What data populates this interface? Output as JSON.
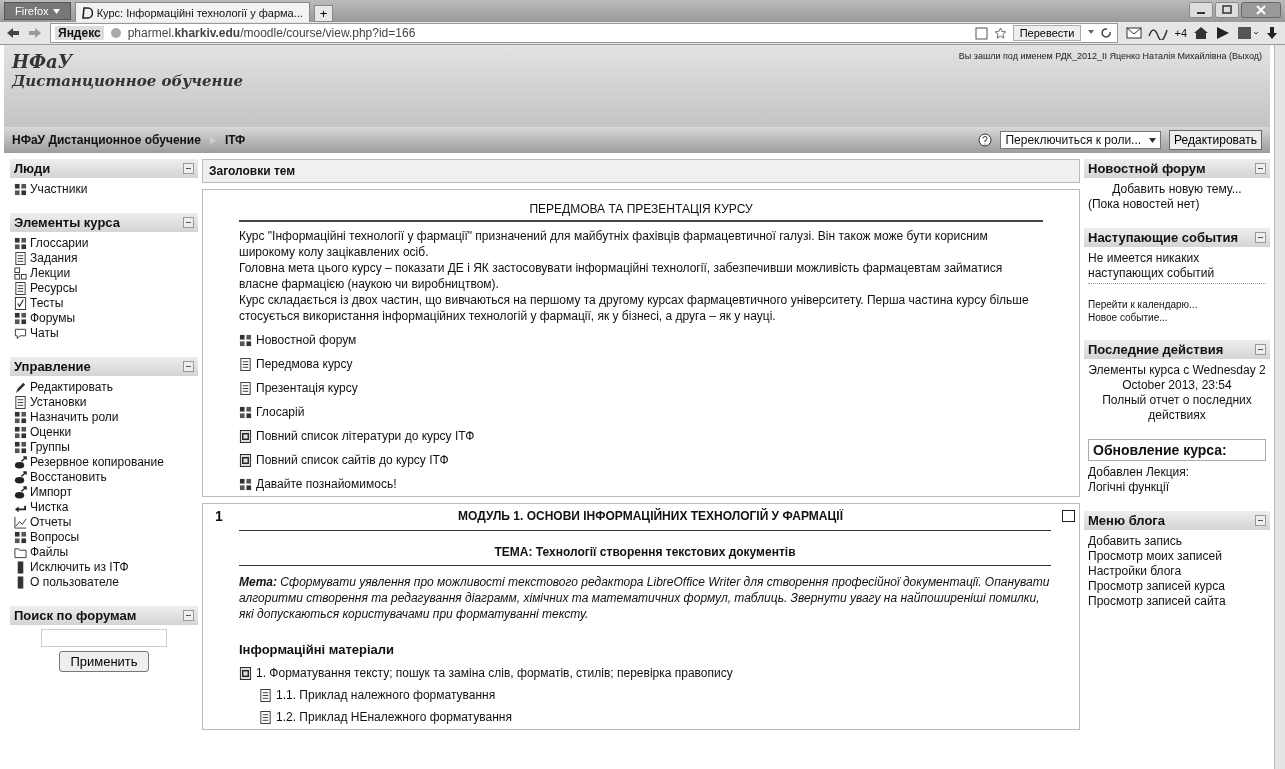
{
  "browser": {
    "menu_button": "Firefox",
    "tab_title": "Курс: Інформаційні технології у фарма...",
    "new_tab": "+",
    "url": "pharmel.**kharkiv.edu**/moodle/course/view.php?id=166",
    "search_brand": "Яндекс",
    "translate_button": "Перевести",
    "addon_badge": "+4"
  },
  "header": {
    "logo_title": "НФаУ",
    "logo_subtitle": "Дистанционное обучение",
    "login_text": "Вы зашли под именем РДК_2012_II Яценко Наталія Михайлівна",
    "logout_link": "(Выход)"
  },
  "navbar": {
    "breadcrumbs": [
      "НФаУ Дистанционное обучение",
      "ІТФ"
    ],
    "role_select": "Переключиться к роли...",
    "edit_button": "Редактировать"
  },
  "left_blocks": [
    {
      "title": "Люди",
      "kind": "list",
      "items": [
        {
          "label": "Участники",
          "kind": "people"
        }
      ]
    },
    {
      "title": "Элементы курса",
      "kind": "list",
      "items": [
        {
          "label": "Глоссарии",
          "kind": "glossary"
        },
        {
          "label": "Задания",
          "kind": "assign"
        },
        {
          "label": "Лекции",
          "kind": "lesson"
        },
        {
          "label": "Ресурсы",
          "kind": "resource"
        },
        {
          "label": "Тесты",
          "kind": "quiz"
        },
        {
          "label": "Форумы",
          "kind": "forum"
        },
        {
          "label": "Чаты",
          "kind": "chat"
        }
      ]
    },
    {
      "title": "Управление",
      "kind": "list",
      "items": [
        {
          "label": "Редактировать",
          "kind": "edit"
        },
        {
          "label": "Установки",
          "kind": "resource"
        },
        {
          "label": "Назначить роли",
          "kind": "people"
        },
        {
          "label": "Оценки",
          "kind": "forum"
        },
        {
          "label": "Группы",
          "kind": "people"
        },
        {
          "label": "Резервное копирование",
          "kind": "backup"
        },
        {
          "label": "Восстановить",
          "kind": "backup"
        },
        {
          "label": "Импорт",
          "kind": "backup"
        },
        {
          "label": "Чистка",
          "kind": "reset"
        },
        {
          "label": "Отчеты",
          "kind": "reports"
        },
        {
          "label": "Вопросы",
          "kind": "questions"
        },
        {
          "label": "Файлы",
          "kind": "files"
        },
        {
          "label": "Исключить из ІТФ",
          "kind": "user"
        },
        {
          "label": "О пользователе",
          "kind": "user"
        }
      ]
    },
    {
      "title": "Поиск по форумам",
      "kind": "search",
      "button": "Применить"
    }
  ],
  "center": {
    "header": "Заголовки тем",
    "intro": {
      "title": "ПЕРЕДМОВА ТА ПРЕЗЕНТАЦІЯ КУРСУ",
      "paragraphs": [
        "Курс \"Інформаційні технології у фармації\" призначений для майбутніх фахівців фармацевтичної галузі. Він також може бути корисним широкому колу зацікавлених осіб.",
        "Головна мета цього курсу – показати ДЕ і ЯК застосовувати інформаційні технології, забезпечивши можливість фармацевтам займатися власне фармацією (наукою чи виробництвом).",
        "Курс складається із двох частин, що вивчаються на першому та другому курсах фармацевтичного університету. Перша частина курсу більше стосується використання інформаційних технологій у фармації, як у бізнесі, а друга – як у науці."
      ],
      "activities": [
        {
          "label": "Новостной форум",
          "kind": "forum"
        },
        {
          "label": "Передмова курсу",
          "kind": "page"
        },
        {
          "label": "Презентація курсу",
          "kind": "page"
        },
        {
          "label": "Глосарій",
          "kind": "glossary"
        },
        {
          "label": "Повний список літератури до курсу ІТФ",
          "kind": "pdf"
        },
        {
          "label": "Повний список сайтів до курсу ІТФ",
          "kind": "pdf"
        },
        {
          "label": "Давайте познайомимось!",
          "kind": "forum"
        }
      ]
    },
    "module": {
      "number": "1",
      "title": "МОДУЛЬ 1. ОСНОВИ ІНФОРМАЦІЙНИХ ТЕХНОЛОГІЙ У ФАРМАЦІЇ",
      "topic": "ТЕМА: Технології створення текстових документів",
      "goal": "**Мета:** Сформувати уявлення про можливості текстового редактора LibreOffice Writer для створення професійної документації. Опанувати алгоритми створення та редагування діаграмм, хімічних та математичних формул, таблиць. Звернути увагу на найпоширеніші помилки, які допускаються користувачами при форматуванні тексту.",
      "subheading": "Інформаційні матеріали",
      "materials": [
        {
          "label": "1. Форматування тексту; пошук та заміна слів, форматів, стилів; перевірка правопису",
          "kind": "pdf",
          "children": [
            {
              "label": "1.1. Приклад належного форматування",
              "kind": "doc"
            },
            {
              "label": "1.2. Приклад НЕналежного форматування",
              "kind": "doc"
            }
          ]
        }
      ]
    }
  },
  "right_blocks": [
    {
      "title": "Новостной форум",
      "collapsible": true,
      "lines": [
        {
          "text": "Добавить новую тему...",
          "kind": "center"
        },
        {
          "text": "(Пока новостей нет)",
          "kind": "text"
        }
      ]
    },
    {
      "title": "Наступающие события",
      "collapsible": true,
      "lines": [
        {
          "text": "Не имеется никаких наступающих событий",
          "kind": "dotted"
        },
        {
          "text": "Перейти к календарю...",
          "kind": "small"
        },
        {
          "text": "Новое событие...",
          "kind": "small"
        }
      ]
    },
    {
      "title": "Последние действия",
      "collapsible": true,
      "lines": [
        {
          "text": "Элементы курса с Wednesday 2 October 2013, 23:54",
          "kind": "center"
        },
        {
          "text": "Полный отчет о последних действиях",
          "kind": "center"
        }
      ]
    },
    {
      "title": "Обновление курса:",
      "collapsible": false,
      "lines": [
        {
          "text": "Добавлен Лекция:",
          "kind": "text"
        },
        {
          "text": "Логічні функції",
          "kind": "text"
        }
      ]
    },
    {
      "title": "Меню блога",
      "collapsible": true,
      "lines": [
        {
          "text": "Добавить запись",
          "kind": "text"
        },
        {
          "text": "Просмотр моих записей",
          "kind": "text"
        },
        {
          "text": "Настройки блога",
          "kind": "text"
        },
        {
          "text": "Просмотр записей курса",
          "kind": "text"
        },
        {
          "text": "Просмотр записей сайта",
          "kind": "text"
        }
      ]
    }
  ]
}
